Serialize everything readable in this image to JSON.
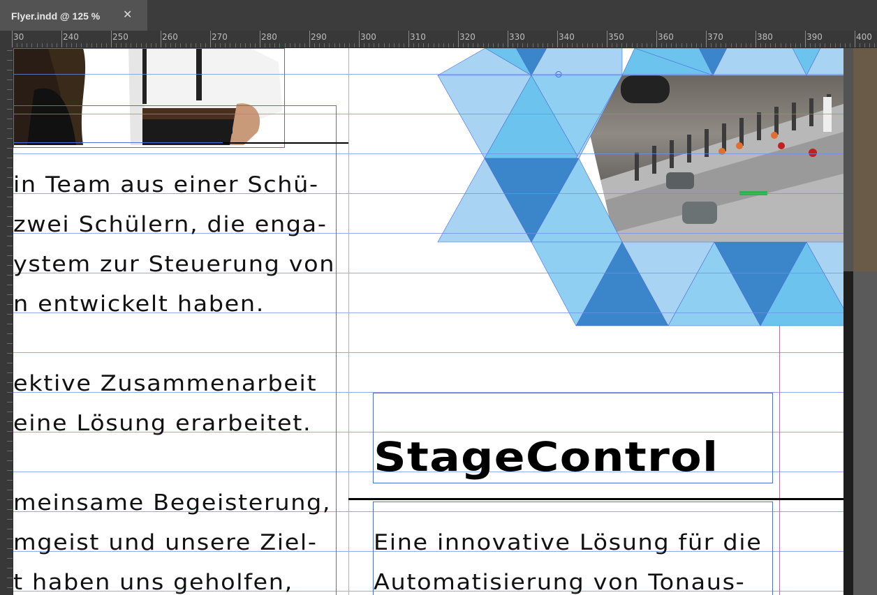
{
  "document_tab": {
    "title": "Flyer.indd @ 125 %",
    "close_glyph": "✕"
  },
  "ruler": {
    "labels": [
      "30",
      "240",
      "250",
      "260",
      "270",
      "280",
      "290",
      "300",
      "310",
      "320",
      "330",
      "340",
      "350",
      "360",
      "370",
      "380",
      "390",
      "400"
    ]
  },
  "left_column": {
    "paragraph_1": [
      "in Team aus einer Schü-",
      "zwei Schülern, die enga-",
      "ystem zur Steuerung von",
      "n entwickelt haben."
    ],
    "paragraph_2": [
      "ektive Zusammenarbeit",
      " eine Lösung erarbeitet."
    ],
    "paragraph_3": [
      "meinsame Begeisterung,",
      "mgeist und unsere Ziel-",
      "t haben uns geholfen,"
    ]
  },
  "right_column": {
    "headline": "StageControl",
    "intro": [
      "Eine innovative Lösung für die",
      "Automatisierung von Tonaus-"
    ]
  },
  "colors": {
    "tri_light": "#a9d3f2",
    "tri_mid": "#6cc4ee",
    "tri_dark": "#3b85ca",
    "guide_blue": "#6f8fe8",
    "guide_cyan": "#66ccee",
    "margin_magenta": "#b06fb0"
  },
  "images": {
    "people_photo": "team-photo",
    "mixer_photo": "audio-mixer-photo"
  }
}
